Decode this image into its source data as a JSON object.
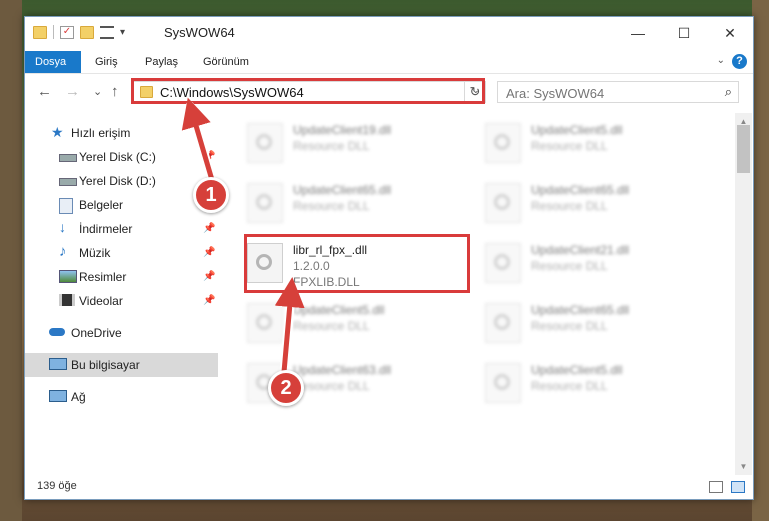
{
  "colors": {
    "accent": "#1979ca",
    "highlight": "#d93b3b",
    "marker": "#d6403a",
    "folder": "#f3d067"
  },
  "window": {
    "title": "SysWOW64",
    "controls": {
      "minimize": "—",
      "maximize": "☐",
      "close": "✕"
    }
  },
  "quick_access_toolbar": {
    "icons": [
      "folder-icon",
      "properties-icon",
      "new-folder-icon",
      "customize-icon"
    ],
    "dropdown": "▾"
  },
  "ribbon": {
    "tabs": [
      {
        "label": "Dosya",
        "active": true
      },
      {
        "label": "Giriş",
        "active": false
      },
      {
        "label": "Paylaş",
        "active": false
      },
      {
        "label": "Görünüm",
        "active": false
      }
    ],
    "help": "?",
    "expand": "⌄"
  },
  "navigation": {
    "back": "←",
    "forward": "→",
    "recent": "⌄",
    "up": "↑",
    "address": "C:\\Windows\\SysWOW64",
    "address_dropdown": "⌄",
    "refresh": "↻",
    "search_placeholder": "Ara: SysWOW64",
    "search_icon": "⌕"
  },
  "sidebar": {
    "items": [
      {
        "label": "Hızlı erişim",
        "icon": "star-icon",
        "pinned": false
      },
      {
        "label": "Yerel Disk (C:)",
        "icon": "drive-icon",
        "pinned": true
      },
      {
        "label": "Yerel Disk (D:)",
        "icon": "drive-icon",
        "pinned": true
      },
      {
        "label": "Belgeler",
        "icon": "documents-icon",
        "pinned": true
      },
      {
        "label": "İndirmeler",
        "icon": "download-icon",
        "pinned": true
      },
      {
        "label": "Müzik",
        "icon": "music-icon",
        "pinned": true
      },
      {
        "label": "Resimler",
        "icon": "pictures-icon",
        "pinned": true
      },
      {
        "label": "Videolar",
        "icon": "videos-icon",
        "pinned": true
      },
      {
        "label": "OneDrive",
        "icon": "cloud-icon",
        "pinned": false
      },
      {
        "label": "Bu bilgisayar",
        "icon": "computer-icon",
        "pinned": false
      },
      {
        "label": "Ağ",
        "icon": "network-icon",
        "pinned": false
      }
    ],
    "pin_glyph": "📌"
  },
  "files": [
    {
      "name": "UpdateClient19.dll",
      "desc": "Resource DLL"
    },
    {
      "name": "UpdateClient5.dll",
      "desc": "Resource DLL"
    },
    {
      "name": "UpdateClient65.dll",
      "desc": "Resource DLL"
    },
    {
      "name": "UpdateClient65.dll",
      "desc": "Resource DLL"
    },
    {
      "name": "libr_rl_fpx_.dll",
      "version": "1.2.0.0",
      "desc": "FPXLIB.DLL"
    },
    {
      "name": "UpdateClient21.dll",
      "desc": "Resource DLL"
    },
    {
      "name": "UpdateClient5.dll",
      "desc": "Resource DLL"
    },
    {
      "name": "UpdateClient65.dll",
      "desc": "Resource DLL"
    },
    {
      "name": "UpdateClient63.dll",
      "desc": "Resource DLL"
    },
    {
      "name": "UpdateClient5.dll",
      "desc": "Resource DLL"
    }
  ],
  "status": {
    "item_count": "139 öğe"
  },
  "annotations": {
    "marker1": "1",
    "marker2": "2"
  }
}
